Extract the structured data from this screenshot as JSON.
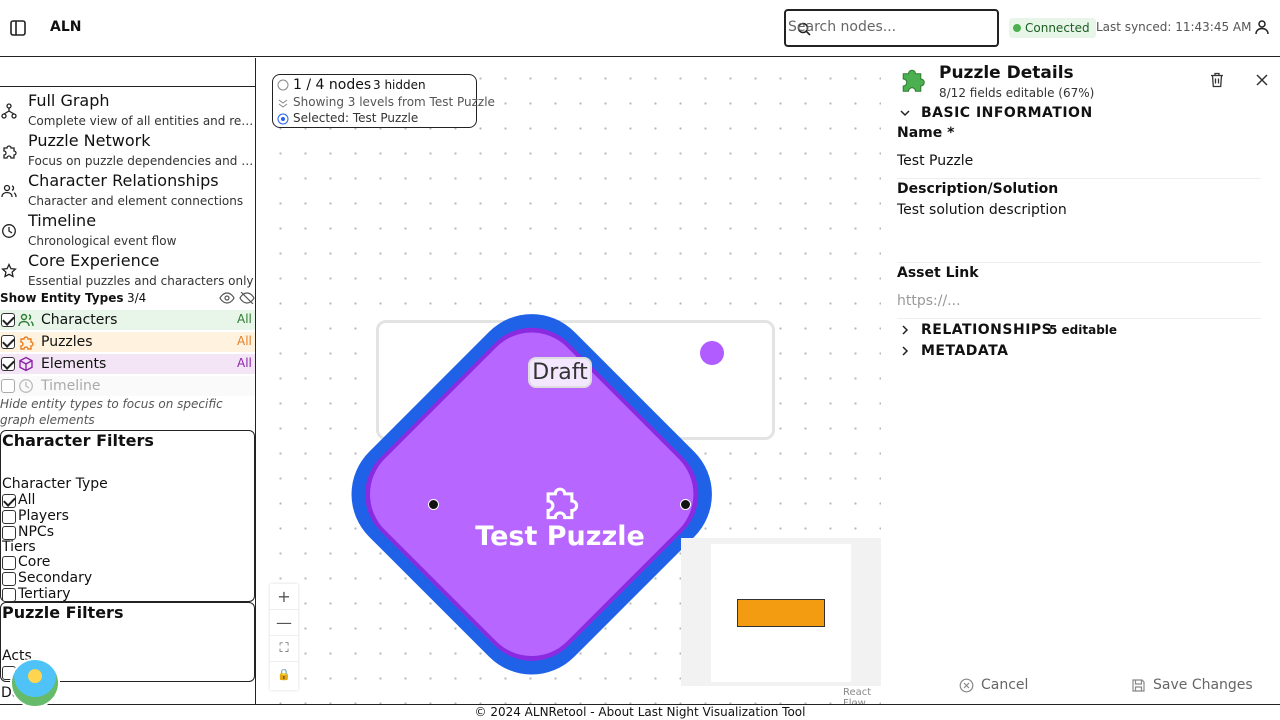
{
  "header": {
    "app_name": "ALN",
    "search_placeholder": "Search nodes...",
    "connection_status": "Connected",
    "last_synced": "Last synced: 11:43:45 AM"
  },
  "sidebar": {
    "views": [
      {
        "title": "Full Graph",
        "desc": "Complete view of all entities and relationships"
      },
      {
        "title": "Puzzle Network",
        "desc": "Focus on puzzle dependencies and rewards"
      },
      {
        "title": "Character Relationships",
        "desc": "Character and element connections"
      },
      {
        "title": "Timeline",
        "desc": "Chronological event flow"
      },
      {
        "title": "Core Experience",
        "desc": "Essential puzzles and characters only"
      }
    ],
    "entity_types": {
      "label": "Show Entity Types",
      "count": "3/4",
      "items": [
        {
          "name": "Characters",
          "all": "All",
          "checked": true,
          "color": "#2e7d32",
          "bg": "#e8f5e9"
        },
        {
          "name": "Puzzles",
          "all": "All",
          "checked": true,
          "color": "#e67e22",
          "bg": "#fff3e0"
        },
        {
          "name": "Elements",
          "all": "All",
          "checked": true,
          "color": "#8e24aa",
          "bg": "#f3e5f5"
        },
        {
          "name": "Timeline",
          "all": "",
          "checked": false,
          "color": "#9e9e9e",
          "bg": "#fafafa"
        }
      ],
      "hint": "Hide entity types to focus on specific graph elements"
    },
    "character_filters": {
      "title": "Character Filters",
      "type_label": "Character Type",
      "types": [
        {
          "label": "All",
          "checked": true
        },
        {
          "label": "Players",
          "checked": false
        },
        {
          "label": "NPCs",
          "checked": false
        }
      ],
      "tiers_label": "Tiers",
      "tiers": [
        {
          "label": "Core",
          "checked": false
        },
        {
          "label": "Secondary",
          "checked": false
        },
        {
          "label": "Tertiary",
          "checked": false
        }
      ]
    },
    "puzzle_filters": {
      "title": "Puzzle Filters",
      "acts_label": "Acts",
      "partial_label": "Da    de"
    }
  },
  "canvas": {
    "info": {
      "nodes": "1 / 4 nodes",
      "hidden": "3 hidden",
      "levels": "Showing 3 levels from Test Puzzle",
      "selected": "Selected: Test Puzzle"
    },
    "node": {
      "status": "Draft",
      "title": "Test Puzzle",
      "fill": "#b767ff",
      "border": "#2563eb"
    },
    "controls": [
      "+",
      "—",
      "⛶",
      "🔒"
    ],
    "attribution": "React Flow"
  },
  "details": {
    "title": "Puzzle Details",
    "subtitle": "8/12 fields editable (67%)",
    "sections": {
      "basic": "BASIC INFORMATION",
      "relationships": "RELATIONSHIPS",
      "relationships_editable": "5 editable",
      "metadata": "METADATA"
    },
    "fields": {
      "name_label": "Name  *",
      "name_value": "Test Puzzle",
      "desc_label": "Description/Solution",
      "desc_value": "Test solution description",
      "asset_label": "Asset Link",
      "asset_placeholder": "https://..."
    },
    "cancel": "Cancel",
    "save": "Save Changes"
  },
  "footer": {
    "text": "© 2024 ALNRetool - About Last Night Visualization Tool"
  }
}
